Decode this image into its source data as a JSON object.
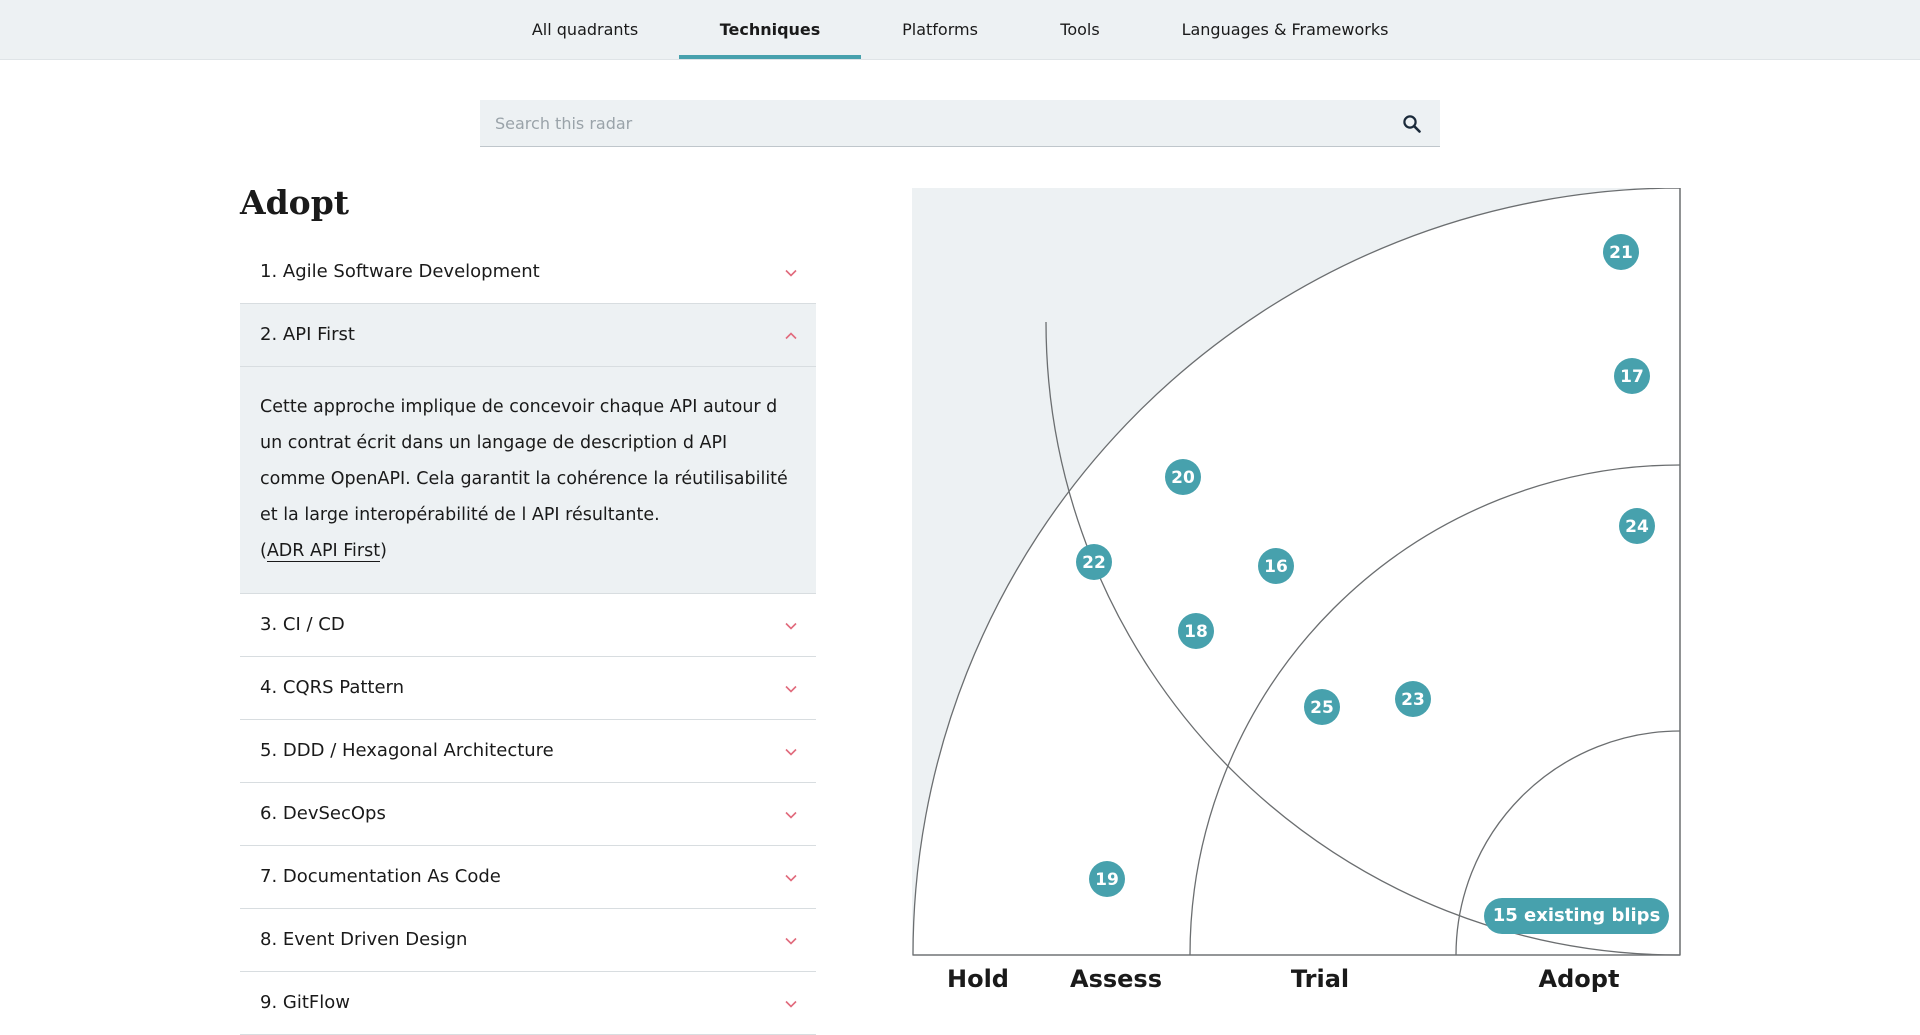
{
  "nav": {
    "tabs": [
      {
        "label": "All quadrants"
      },
      {
        "label": "Techniques"
      },
      {
        "label": "Platforms"
      },
      {
        "label": "Tools"
      },
      {
        "label": "Languages & Frameworks"
      }
    ],
    "active_tab": "Techniques"
  },
  "search": {
    "placeholder": "Search this radar",
    "value": "",
    "icon": "search-icon"
  },
  "ring_title": "Adopt",
  "blips_list": [
    {
      "label": "1. Agile Software Development",
      "expanded": false
    },
    {
      "label": "2. API First",
      "expanded": true,
      "description": "Cette approche implique de concevoir chaque API autour d un contrat écrit dans un langage de description d API comme OpenAPI. Cela garantit la cohérence la réutilisabilité et la large interopérabilité de l API résultante.",
      "link_prefix": "(",
      "link_text": "ADR API First",
      "link_suffix": ")"
    },
    {
      "label": "3. CI / CD",
      "expanded": false
    },
    {
      "label": "4. CQRS Pattern",
      "expanded": false
    },
    {
      "label": "5. DDD / Hexagonal Architecture",
      "expanded": false
    },
    {
      "label": "6. DevSecOps",
      "expanded": false
    },
    {
      "label": "7. Documentation As Code",
      "expanded": false
    },
    {
      "label": "8. Event Driven Design",
      "expanded": false
    },
    {
      "label": "9. GitFlow",
      "expanded": false
    }
  ],
  "radar": {
    "rings": [
      {
        "label": "Hold"
      },
      {
        "label": "Assess"
      },
      {
        "label": "Trial"
      },
      {
        "label": "Adopt"
      }
    ],
    "existing_blips_label": "15 existing blips",
    "blips": [
      {
        "number": "21"
      },
      {
        "number": "17"
      },
      {
        "number": "20"
      },
      {
        "number": "24"
      },
      {
        "number": "22"
      },
      {
        "number": "16"
      },
      {
        "number": "18"
      },
      {
        "number": "23"
      },
      {
        "number": "25"
      },
      {
        "number": "19"
      }
    ]
  },
  "colors": {
    "accent": "#47a1ad",
    "chevron": "#e16a7c",
    "panel_bg": "#edf1f3",
    "text": "#1a1a1a",
    "ring_line": "#6b6e70"
  }
}
